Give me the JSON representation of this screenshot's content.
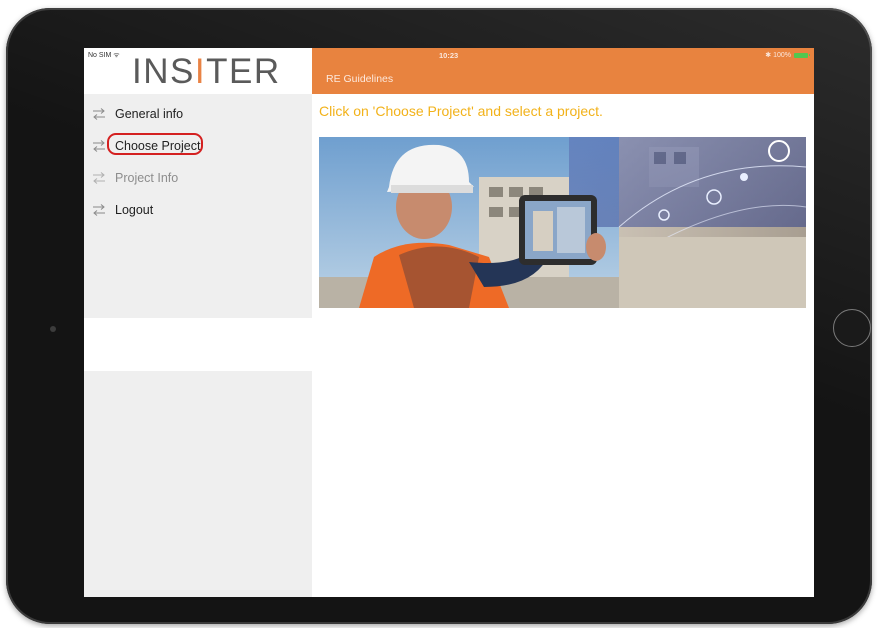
{
  "status_bar": {
    "carrier": "No SIM ᯤ",
    "time": "10:23",
    "battery": "✱ 100%"
  },
  "sidebar": {
    "logo_text_a": "I",
    "logo_text_b": "NS",
    "logo_text_c": "I",
    "logo_text_d": "TER",
    "items": [
      {
        "label": "General info",
        "enabled": true
      },
      {
        "label": "Choose Project",
        "enabled": true,
        "highlighted": true
      },
      {
        "label": "Project Info",
        "enabled": false
      },
      {
        "label": "Logout",
        "enabled": true
      }
    ]
  },
  "nav": {
    "title": "RE Guidelines"
  },
  "content": {
    "instruction": "Click on 'Choose Project' and select a project."
  },
  "colors": {
    "accent": "#e8833f",
    "instruction_text": "#f2b21a",
    "highlight_ring": "#d42020",
    "sidebar_bg": "#efefef"
  },
  "icons": {
    "menu": "swap-arrows-icon",
    "battery": "battery-icon"
  }
}
